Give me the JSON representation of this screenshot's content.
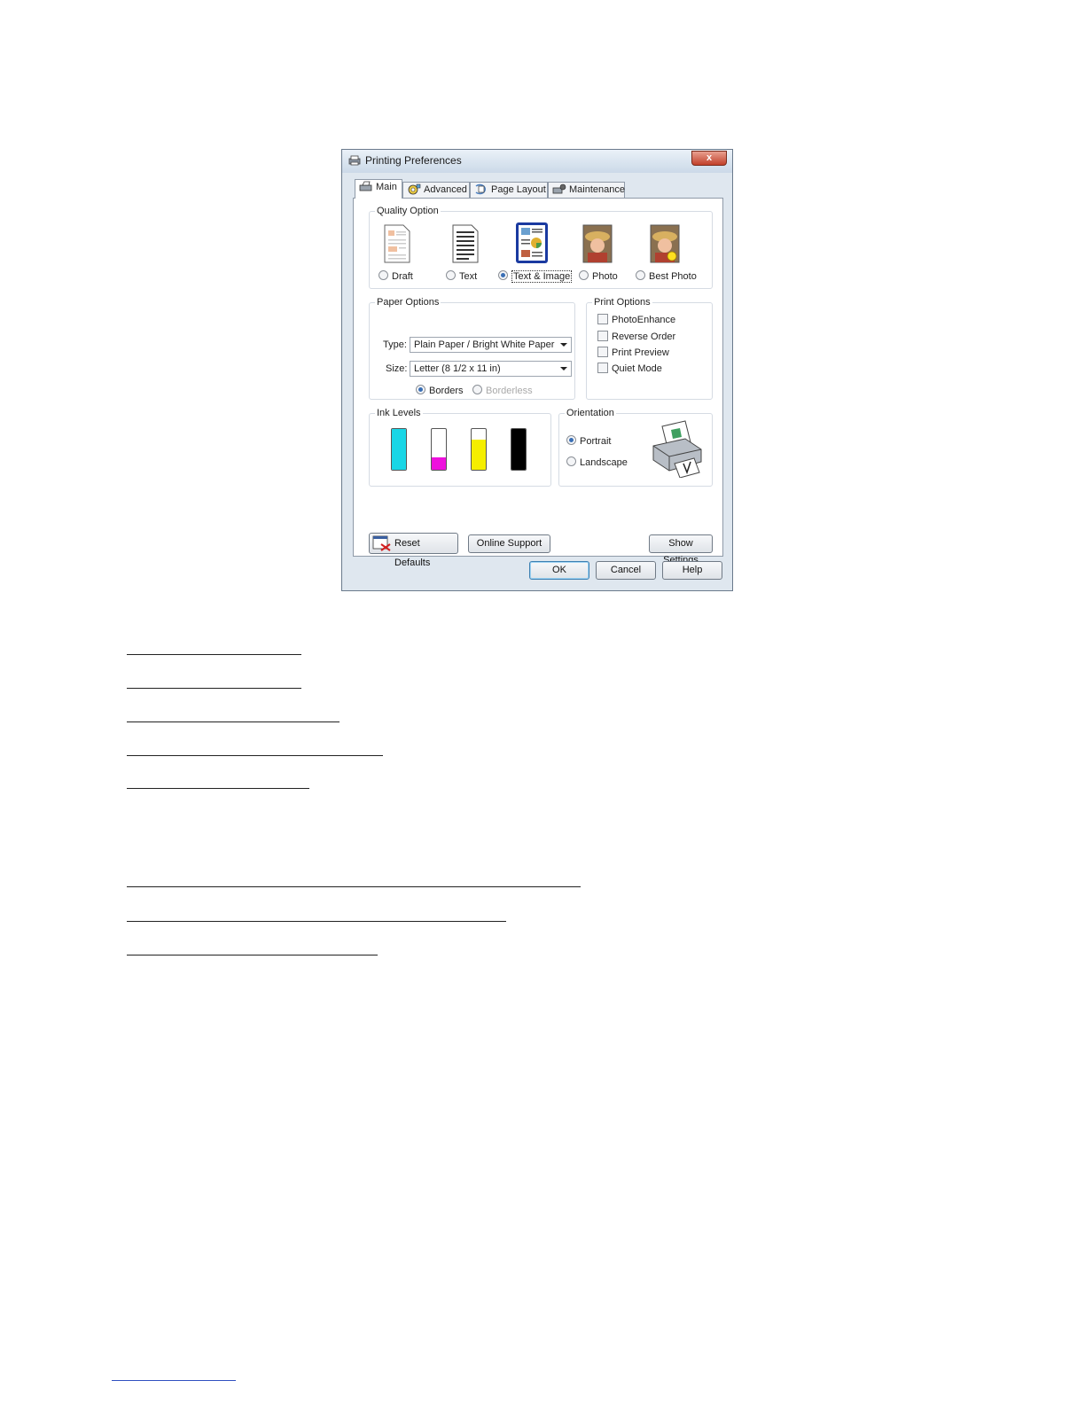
{
  "window": {
    "title": "Printing Preferences",
    "close_label": "x"
  },
  "tabs": [
    {
      "label": "Main",
      "icon": "printer-icon",
      "active": true
    },
    {
      "label": "Advanced",
      "icon": "advanced-gear-icon",
      "active": false
    },
    {
      "label": "Page Layout",
      "icon": "page-layout-icon",
      "active": false
    },
    {
      "label": "Maintenance",
      "icon": "maintenance-icon",
      "active": false
    }
  ],
  "quality": {
    "group_label": "Quality Option",
    "options": [
      {
        "label": "Draft",
        "icon": "draft-document-icon",
        "selected": false
      },
      {
        "label": "Text",
        "icon": "text-document-icon",
        "selected": false
      },
      {
        "label": "Text & Image",
        "icon": "text-image-document-icon",
        "selected": true
      },
      {
        "label": "Photo",
        "icon": "photo-icon",
        "selected": false
      },
      {
        "label": "Best Photo",
        "icon": "best-photo-icon",
        "selected": false
      }
    ]
  },
  "paper": {
    "group_label": "Paper Options",
    "type_label": "Type:",
    "type_value": "Plain Paper / Bright White Paper",
    "size_label": "Size:",
    "size_value": "Letter (8 1/2 x 11 in)",
    "borders_label": "Borders",
    "borderless_label": "Borderless",
    "borders_selected": true
  },
  "print_options": {
    "group_label": "Print Options",
    "items": [
      {
        "label": "PhotoEnhance",
        "checked": false
      },
      {
        "label": "Reverse Order",
        "checked": false
      },
      {
        "label": "Print Preview",
        "checked": false
      },
      {
        "label": "Quiet Mode",
        "checked": false
      }
    ]
  },
  "ink": {
    "group_label": "Ink Levels",
    "cartridges": [
      {
        "color": "#19d6e6",
        "level": 1.0
      },
      {
        "color": "#ee11dd",
        "level": 0.3
      },
      {
        "color": "#f5ee00",
        "level": 0.75
      },
      {
        "color": "#000000",
        "level": 1.0
      }
    ]
  },
  "orientation": {
    "group_label": "Orientation",
    "portrait_label": "Portrait",
    "landscape_label": "Landscape",
    "portrait_selected": true,
    "icon": "printer-portrait-icon"
  },
  "panel_buttons": {
    "reset": "Reset Defaults",
    "online_support": "Online Support",
    "show_settings": "Show Settings"
  },
  "dialog_buttons": {
    "ok": "OK",
    "cancel": "Cancel",
    "help": "Help"
  }
}
